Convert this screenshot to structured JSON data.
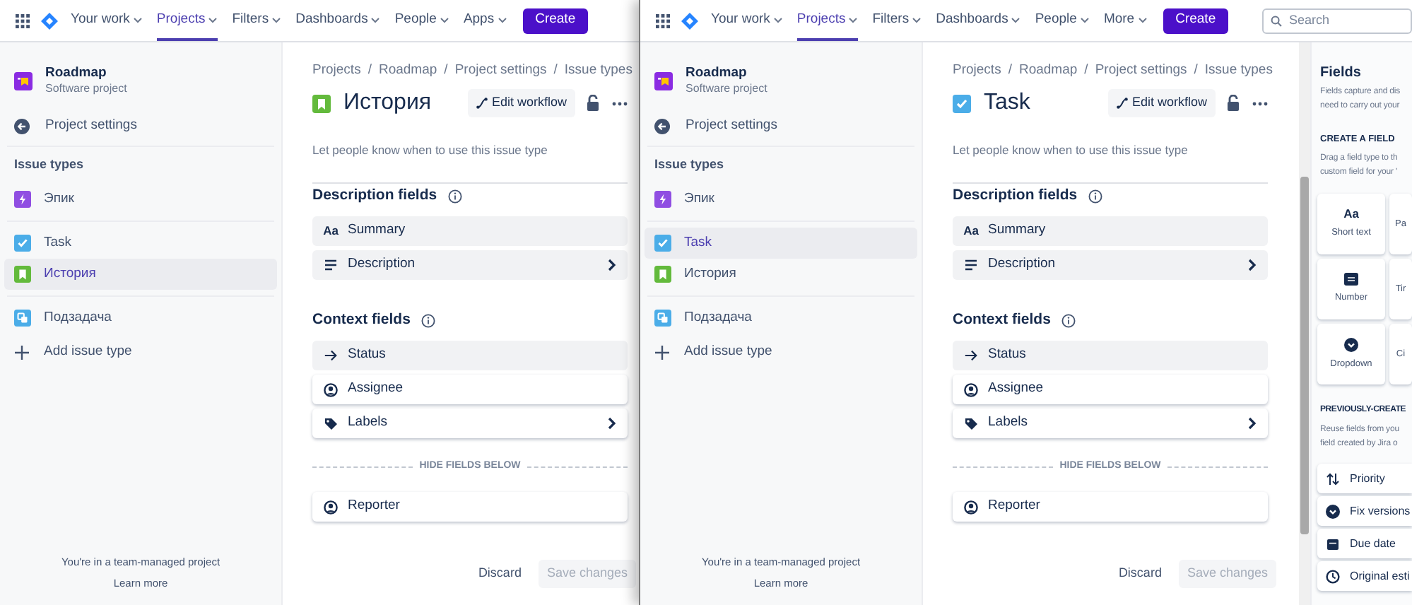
{
  "windows": [
    {
      "nav": {
        "items": [
          {
            "label": "Your work",
            "selected": false
          },
          {
            "label": "Projects",
            "selected": true
          },
          {
            "label": "Filters",
            "selected": false
          },
          {
            "label": "Dashboards",
            "selected": false
          },
          {
            "label": "People",
            "selected": false
          },
          {
            "label": "Apps",
            "selected": false
          }
        ],
        "create": "Create"
      },
      "sidebar": {
        "project_name": "Roadmap",
        "project_type": "Software project",
        "back_label": "Project settings",
        "section_title": "Issue types",
        "groups": [
          {
            "items": [
              {
                "label": "Эпик",
                "kind": "epic",
                "selected": false
              }
            ]
          },
          {
            "items": [
              {
                "label": "Task",
                "kind": "task",
                "selected": false
              },
              {
                "label": "История",
                "kind": "story",
                "selected": true
              }
            ]
          },
          {
            "items": [
              {
                "label": "Подзадача",
                "kind": "subtask",
                "selected": false
              }
            ]
          }
        ],
        "add_label": "Add issue type",
        "footer_text": "You're in a team-managed project",
        "footer_link": "Learn more"
      },
      "main": {
        "breadcrumbs": [
          "Projects",
          "Roadmap",
          "Project settings",
          "Issue types"
        ],
        "breadcrumb_separator": "/",
        "title": {
          "text": "История",
          "kind": "story"
        },
        "edit_workflow": "Edit workflow",
        "description": "Let people know when to use this issue type",
        "sections": [
          {
            "title": "Description fields",
            "fields": [
              {
                "label": "Summary",
                "kind": "short-text",
                "glyph": "Aa",
                "locked": true,
                "expandable": false
              },
              {
                "label": "Description",
                "kind": "paragraph",
                "locked": true,
                "expandable": true
              }
            ]
          },
          {
            "title": "Context fields",
            "fields": [
              {
                "label": "Status",
                "kind": "status",
                "locked": true,
                "expandable": false
              },
              {
                "label": "Assignee",
                "kind": "person",
                "locked": false,
                "expandable": false
              },
              {
                "label": "Labels",
                "kind": "labels",
                "locked": false,
                "expandable": true
              }
            ]
          }
        ],
        "divider_label": "HIDE FIELDS BELOW",
        "hidden_fields": [
          {
            "label": "Reporter",
            "kind": "person",
            "locked": false,
            "expandable": false
          }
        ],
        "discard": "Discard",
        "save": {
          "label": "Save changes",
          "disabled": true
        }
      }
    },
    {
      "nav": {
        "items": [
          {
            "label": "Your work",
            "selected": false
          },
          {
            "label": "Projects",
            "selected": true
          },
          {
            "label": "Filters",
            "selected": false
          },
          {
            "label": "Dashboards",
            "selected": false
          },
          {
            "label": "People",
            "selected": false
          },
          {
            "label": "More",
            "selected": false
          }
        ],
        "create": "Create",
        "search": {
          "placeholder": "Search"
        }
      },
      "sidebar": {
        "project_name": "Roadmap",
        "project_type": "Software project",
        "back_label": "Project settings",
        "section_title": "Issue types",
        "groups": [
          {
            "items": [
              {
                "label": "Эпик",
                "kind": "epic",
                "selected": false
              }
            ]
          },
          {
            "items": [
              {
                "label": "Task",
                "kind": "task",
                "selected": true
              },
              {
                "label": "История",
                "kind": "story",
                "selected": false
              }
            ]
          },
          {
            "items": [
              {
                "label": "Подзадача",
                "kind": "subtask",
                "selected": false
              }
            ]
          }
        ],
        "add_label": "Add issue type",
        "footer_text": "You're in a team-managed project",
        "footer_link": "Learn more"
      },
      "main": {
        "breadcrumbs": [
          "Projects",
          "Roadmap",
          "Project settings",
          "Issue types"
        ],
        "breadcrumb_separator": "/",
        "title": {
          "text": "Task",
          "kind": "task"
        },
        "edit_workflow": "Edit workflow",
        "description": "Let people know when to use this issue type",
        "sections": [
          {
            "title": "Description fields",
            "fields": [
              {
                "label": "Summary",
                "kind": "short-text",
                "glyph": "Aa",
                "locked": true,
                "expandable": false
              },
              {
                "label": "Description",
                "kind": "paragraph",
                "locked": true,
                "expandable": true
              }
            ]
          },
          {
            "title": "Context fields",
            "fields": [
              {
                "label": "Status",
                "kind": "status",
                "locked": true,
                "expandable": false
              },
              {
                "label": "Assignee",
                "kind": "person",
                "locked": false,
                "expandable": false
              },
              {
                "label": "Labels",
                "kind": "labels",
                "locked": false,
                "expandable": true
              }
            ]
          }
        ],
        "divider_label": "HIDE FIELDS BELOW",
        "hidden_fields": [
          {
            "label": "Reporter",
            "kind": "person",
            "locked": false,
            "expandable": false
          }
        ],
        "discard": "Discard",
        "save": {
          "label": "Save changes",
          "disabled": true
        }
      },
      "fields_panel": {
        "title": "Fields",
        "intro_lines": [
          "Fields capture and dis",
          "need to carry out your"
        ],
        "create_title": "CREATE A FIELD",
        "create_lines": [
          "Drag a field type to th",
          "custom field for your '"
        ],
        "field_types": [
          {
            "label": "Short text",
            "kind": "short-text",
            "glyph": "Aa"
          },
          {
            "label": "Pa",
            "kind": "none"
          },
          {
            "label": "Number",
            "kind": "number"
          },
          {
            "label": "Tir",
            "kind": "none"
          },
          {
            "label": "Dropdown",
            "kind": "dropdown"
          },
          {
            "label": "Ci",
            "kind": "none"
          }
        ],
        "previous_title": "PREVIOUSLY-CREATE",
        "previous_lines": [
          "Reuse fields from you",
          "field created by Jira o"
        ],
        "previous_fields": [
          {
            "label": "Priority",
            "kind": "priority"
          },
          {
            "label": "Fix versions",
            "kind": "version"
          },
          {
            "label": "Due date",
            "kind": "date"
          },
          {
            "label": "Original esti",
            "kind": "time"
          }
        ]
      }
    }
  ]
}
